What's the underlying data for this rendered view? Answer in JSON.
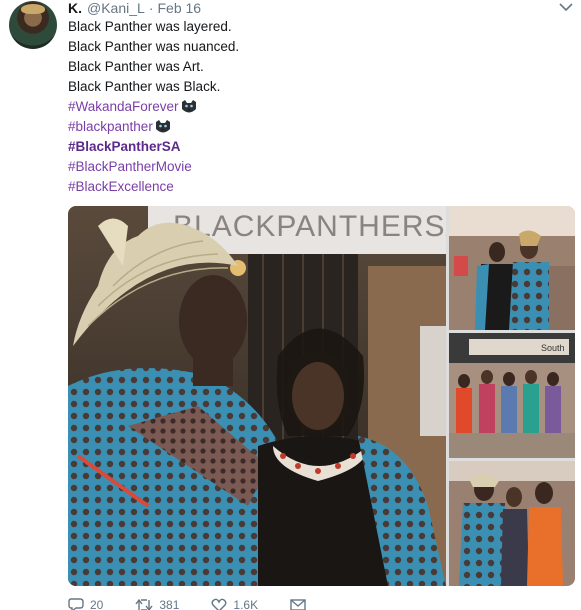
{
  "tweet": {
    "display_name": "K.",
    "handle": "@Kani_L",
    "separator": "·",
    "date": "Feb 16",
    "lines": [
      "Black Panther was layered.",
      "Black Panther was nuanced.",
      "Black Panther was Art.",
      "Black Panther was Black."
    ],
    "hashtags": [
      {
        "text": "#WakandaForever",
        "emoji": "black-panther-emoji"
      },
      {
        "text": "#blackpanther",
        "emoji": "black-panther-emoji"
      },
      {
        "text": "#BlackPantherSA",
        "emoji": ""
      },
      {
        "text": "#BlackPantherMovie",
        "emoji": ""
      },
      {
        "text": "#BlackExcellence",
        "emoji": ""
      }
    ],
    "media_sign_text": "BLACKPANTHERSA",
    "side_sign_text": "South",
    "actions": {
      "replies": "20",
      "retweets": "381",
      "likes": "1.6K"
    }
  },
  "colors": {
    "hashtag": "#7a3ea8",
    "text": "#14171a",
    "muted": "#657786"
  }
}
